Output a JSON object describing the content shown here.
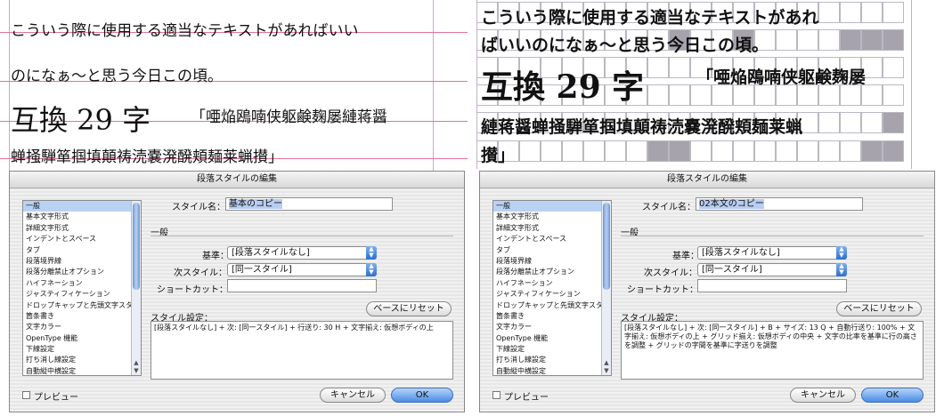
{
  "left": {
    "sample": {
      "line1": "こういう際に使用する適当なテキストがあればいい",
      "line2": "のになぁ～と思う今日この頃。",
      "big": "互換 29 字",
      "small_after_big": "「唖焔鴎喃侠躯鹸麹屡縺蒋醤",
      "line4": "蝉掻騨箪掴填顛祷涜嚢溌醗頬麺莱蝋攅」"
    },
    "dialog": {
      "title": "段落スタイルの編集",
      "list_items": [
        "一般",
        "基本文字形式",
        "詳細文字形式",
        "インデントとスペース",
        "タブ",
        "段落境界線",
        "段落分離禁止オプション",
        "ハイフネーション",
        "ジャスティフィケーション",
        "ドロップキャップと先頭文字スタイル",
        "箇条書き",
        "文字カラー",
        "OpenType 機能",
        "下線設定",
        "打ち消し線設定",
        "自動縦中横設定"
      ],
      "style_name_label": "スタイル名：",
      "style_name_value": "基本のコピー",
      "general_label": "一般",
      "based_on_label": "基準：",
      "based_on_value": "[段落スタイルなし]",
      "next_style_label": "次スタイル：",
      "next_style_value": "[同一スタイル]",
      "shortcut_label": "ショートカット：",
      "shortcut_value": "",
      "reset_button": "ベースにリセット",
      "style_settings_label": "スタイル設定：",
      "style_settings_text": "[段落スタイルなし] + 次: [同一スタイル] + 行送り: 30 H + 文字揃え: 仮想ボディの上",
      "preview_label": "プレビュー",
      "cancel_button": "キャンセル",
      "ok_button": "OK"
    }
  },
  "right": {
    "sample": {
      "line1": "こういう際に使用する適当なテキストがあれ",
      "line2": "ばいいのになぁ～と思う今日この頃。",
      "big": "互換 29 字",
      "small_after_big": "「唖焔鴎喃侠躯鹸麹屡",
      "line4": "縺蒋醤蝉掻騨箪掴填顛祷涜嚢溌醗頬麺莱蝋",
      "line5": "攅」"
    },
    "dialog": {
      "title": "段落スタイルの編集",
      "list_items": [
        "一般",
        "基本文字形式",
        "詳細文字形式",
        "インデントとスペース",
        "タブ",
        "段落境界線",
        "段落分離禁止オプション",
        "ハイフネーション",
        "ジャスティフィケーション",
        "ドロップキャップと先頭文字スタイル",
        "箇条書き",
        "文字カラー",
        "OpenType 機能",
        "下線設定",
        "打ち消し線設定",
        "自動縦中横設定"
      ],
      "style_name_label": "スタイル名：",
      "style_name_value": "02本文のコピー",
      "general_label": "一般",
      "based_on_label": "基準：",
      "based_on_value": "[段落スタイルなし]",
      "next_style_label": "次スタイル：",
      "next_style_value": "[同一スタイル]",
      "shortcut_label": "ショートカット：",
      "shortcut_value": "",
      "reset_button": "ベースにリセット",
      "style_settings_label": "スタイル設定：",
      "style_settings_text": "[段落スタイルなし] + 次: [同一スタイル] + B + サイズ: 13 Q + 自動行送り: 100% + 文字揃え: 仮想ボディの上 + グリッド揃え: 仮想ボディの中央 + 文字の比率を基準に行の高さを調整 + グリッドの字間を基準に字送りを調整",
      "preview_label": "プレビュー",
      "cancel_button": "キャンセル",
      "ok_button": "OK"
    }
  },
  "colors": {
    "baseline_pink": "#e2739b",
    "frame_purple": "#caa8d6",
    "grid_gray": "#a6a3ad",
    "ok_blue": "#4a8de5",
    "selection_blue": "#b9d2f3"
  },
  "icons": [
    "checkbox-icon",
    "popup-arrows-icon",
    "scroll-arrow-up-icon",
    "scroll-arrow-down-icon"
  ]
}
